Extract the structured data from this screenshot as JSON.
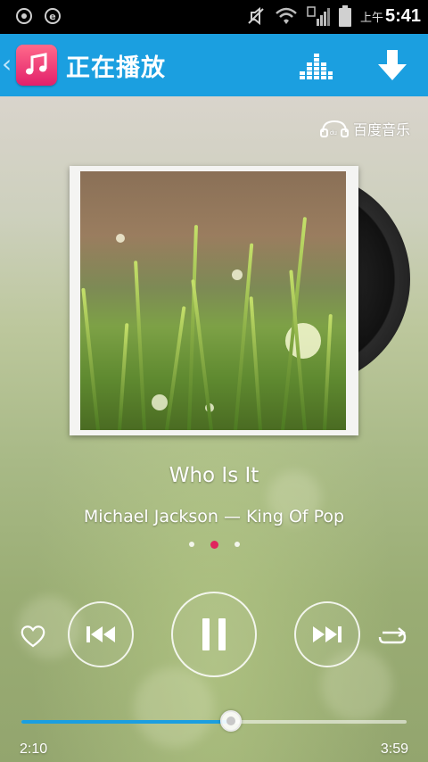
{
  "status_bar": {
    "time_prefix": "上午",
    "time": "5:41",
    "icons": [
      "target-icon",
      "e-app-icon",
      "mute-icon",
      "wifi-icon",
      "signal-icon",
      "battery-icon"
    ]
  },
  "header": {
    "title": "正在播放",
    "icons": [
      "back-chevron-icon",
      "music-note-icon",
      "equalizer-icon",
      "download-icon"
    ],
    "accent_color": "#1b9fe0"
  },
  "brand": {
    "logo_text": "百度音乐"
  },
  "now_playing": {
    "title": "Who Is It",
    "subtitle": "Michael Jackson — King Of Pop",
    "page_count": 3,
    "active_page": 2
  },
  "controls": {
    "icons": [
      "heart-icon",
      "previous-icon",
      "pause-icon",
      "next-icon",
      "repeat-icon"
    ]
  },
  "progress": {
    "elapsed": "2:10",
    "total": "3:59",
    "fraction": 0.544
  }
}
